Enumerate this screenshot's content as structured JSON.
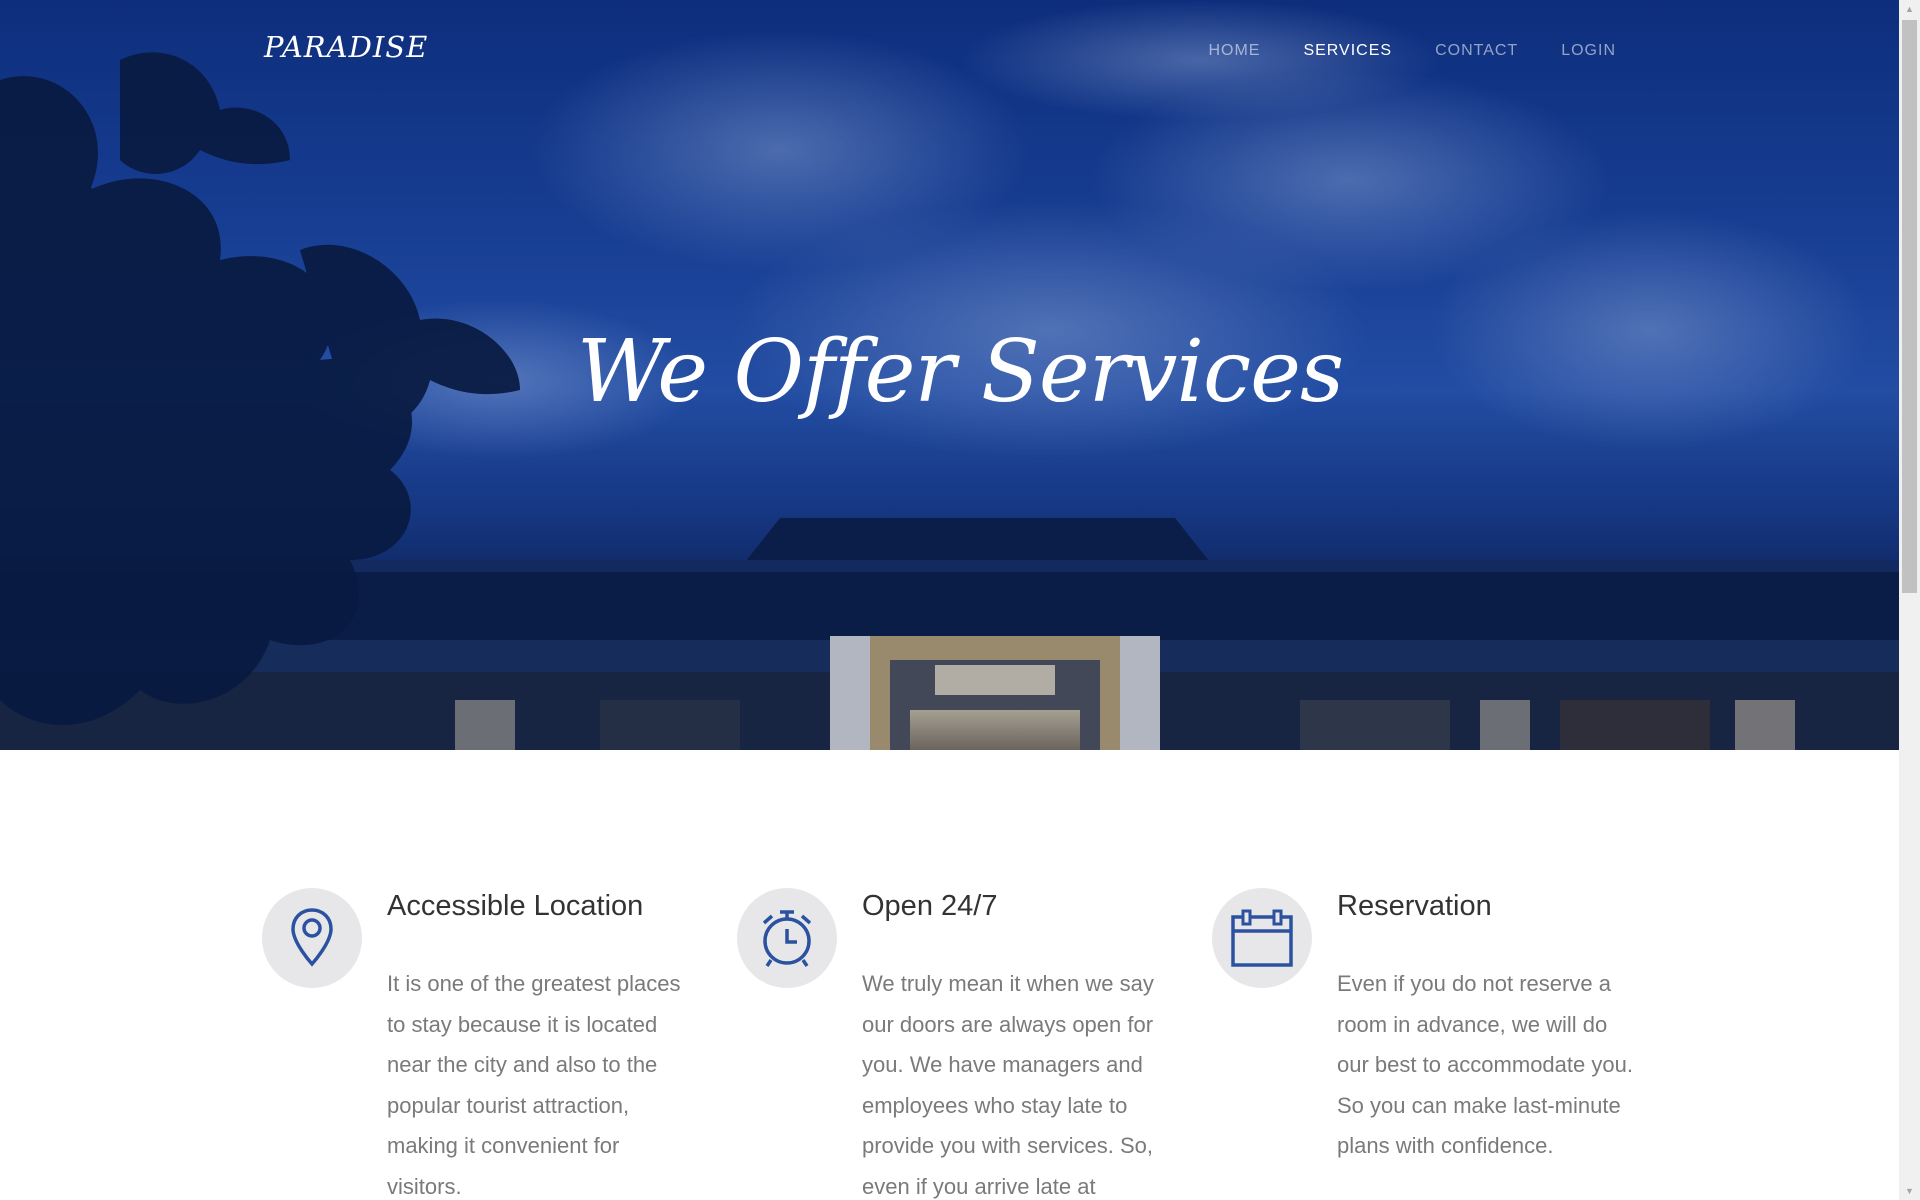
{
  "brand": {
    "name": "PARADISE"
  },
  "nav": {
    "items": [
      {
        "label": "HOME",
        "active": false
      },
      {
        "label": "SERVICES",
        "active": true
      },
      {
        "label": "CONTACT",
        "active": false
      },
      {
        "label": "LOGIN",
        "active": false
      }
    ]
  },
  "hero": {
    "title": "We Offer Services"
  },
  "services": [
    {
      "icon": "map-pin-icon",
      "title": "Accessible Location",
      "text": "It is one of the greatest places to stay because it is located near the city and also to the popular tourist attraction, making it convenient for visitors."
    },
    {
      "icon": "alarm-clock-icon",
      "title": "Open 24/7",
      "text": "We truly mean it when we say our doors are always open for you. We have managers and employees who stay late to provide you with services. So, even if you arrive late at"
    },
    {
      "icon": "calendar-icon",
      "title": "Reservation",
      "text": "Even if you do not reserve a room in advance, we will do our best to accommodate you. So you can make last-minute plans with confidence."
    }
  ],
  "colors": {
    "accent": "#2b52a0",
    "icon_bg": "#e7e7ea",
    "heading": "#333333",
    "body_text": "#7a7a7a"
  }
}
